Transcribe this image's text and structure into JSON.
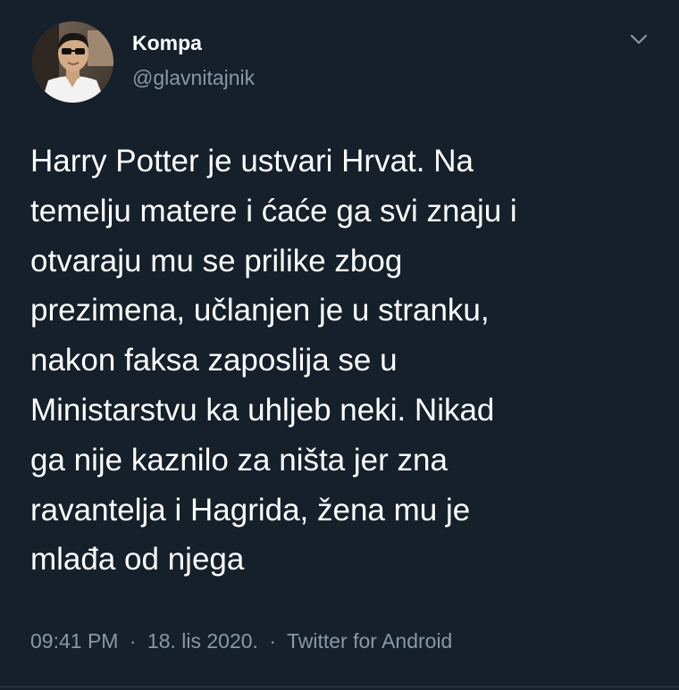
{
  "author": {
    "name": "Kompa",
    "handle": "@glavnitajnik",
    "avatar_icon": "profile-photo"
  },
  "menu_icon": "chevron-down-icon",
  "tweet": {
    "text": "Harry Potter je ustvari Hrvat. Na\ntemelju matere i ćaće ga svi znaju i\notvaraju mu se prilike zbog\nprezimena, učlanjen je u stranku,\nnakon faksa zaposlija se u\nMinistarstvu ka uhljeb neki. Nikad\nga nije kaznilo za ništa jer zna\nravantelja i Hagrida, žena mu je\nmlađa od njega"
  },
  "meta": {
    "time": "09:41 PM",
    "separator": "·",
    "date": "18. lis 2020.",
    "source": "Twitter for Android"
  },
  "colors": {
    "background": "#15202b",
    "text": "#ffffff",
    "secondary": "#8899a6",
    "divider": "#38444d"
  }
}
